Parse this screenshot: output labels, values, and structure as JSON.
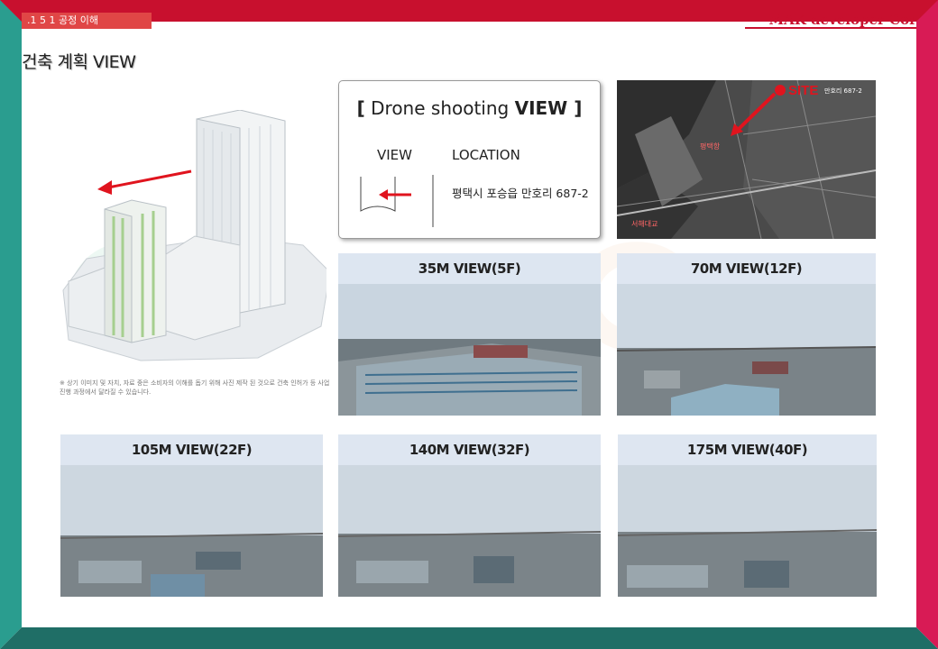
{
  "header": {
    "left_tag": ".1 5 1  공정 이해",
    "right_tag": "MAK developer Cor"
  },
  "page_title": "건축 계획 VIEW",
  "rendering": {
    "disclaimer": "※ 상기 이미지 및 자치, 자료 중은 소비자의 이해를 돕기 위해 사진 제작 된 것으로 건축 인허가 등 사업진행 과정에서 달라질 수 있습니다."
  },
  "drone_card": {
    "bracket_open": "[",
    "title_normal": " Drone shooting ",
    "title_strong": "VIEW",
    "bracket_close": " ]",
    "view_header": "VIEW",
    "location_header": "LOCATION",
    "location_value": "평택시 포승읍 만호리 687-2"
  },
  "map": {
    "site_label": "SITE",
    "site_address": "만호리 687-2",
    "label_port": "평택항",
    "label_bridge": "서해대교"
  },
  "photos": [
    {
      "label": "35M VIEW(5F)"
    },
    {
      "label": "70M VIEW(12F)"
    },
    {
      "label": "105M VIEW(22F)"
    },
    {
      "label": "140M VIEW(32F)"
    },
    {
      "label": "175M VIEW(40F)"
    }
  ],
  "colors": {
    "frame_red": "#c8102e",
    "frame_teal": "#2a9d8f",
    "frame_pink": "#d81b55",
    "arrow_red": "#e0141e"
  }
}
